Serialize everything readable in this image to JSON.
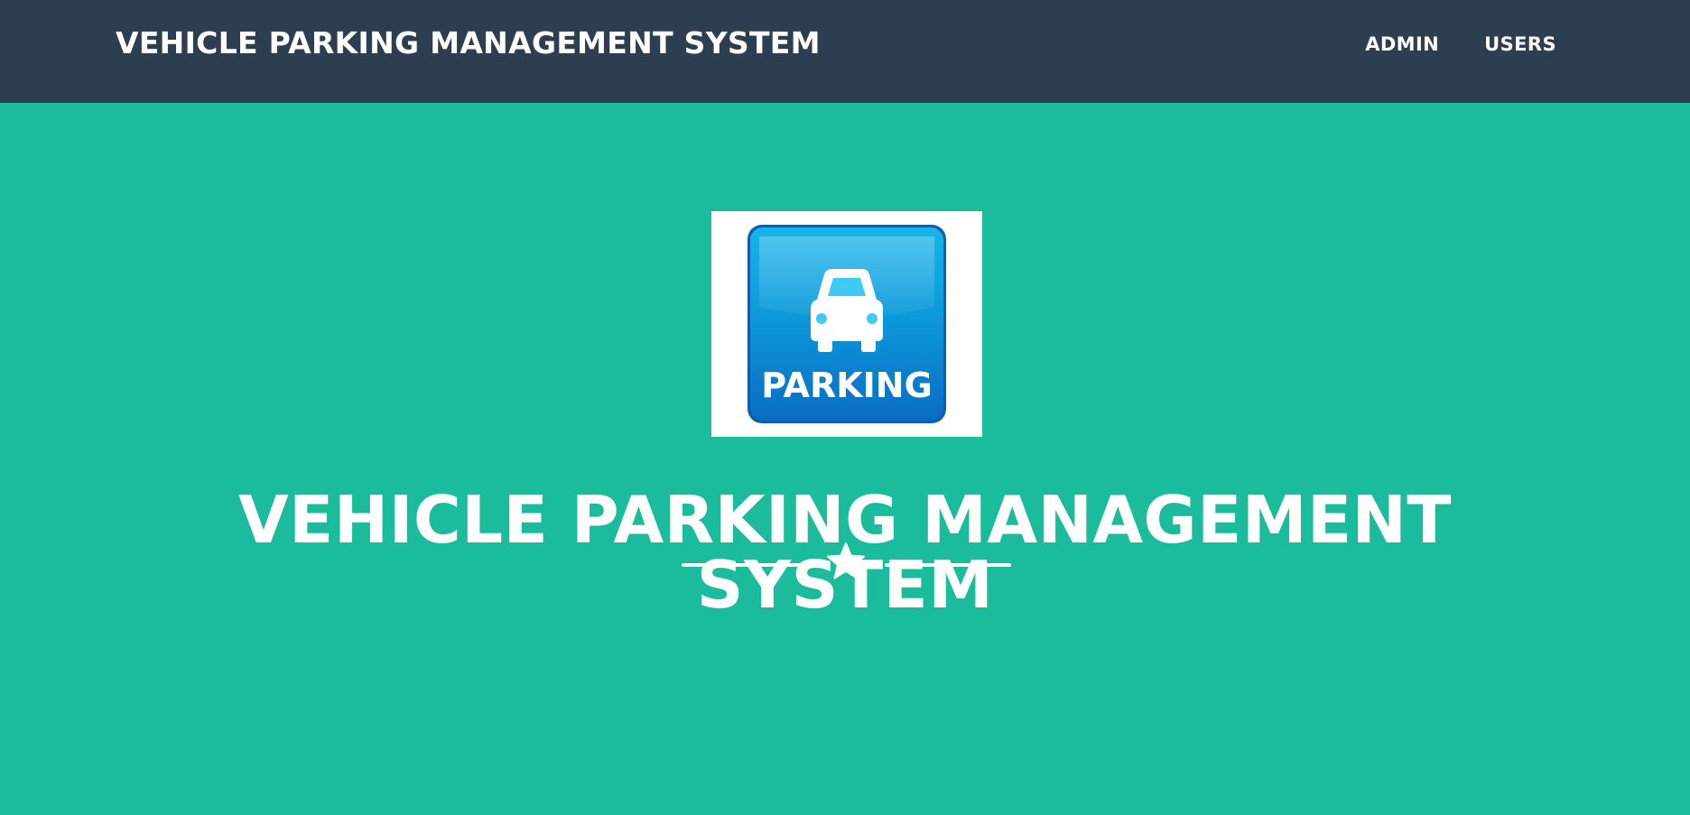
{
  "navbar": {
    "brand": "VEHICLE PARKING MANAGEMENT SYSTEM",
    "links": [
      {
        "label": "ADMIN"
      },
      {
        "label": "USERS"
      }
    ],
    "background_color": "#2c3e50"
  },
  "hero": {
    "logo_text": "PARKING",
    "logo_icon": "car-icon",
    "title": "VEHICLE PARKING MANAGEMENT SYSTEM",
    "divider_icon": "star-icon",
    "background_color": "#1abc9c"
  }
}
